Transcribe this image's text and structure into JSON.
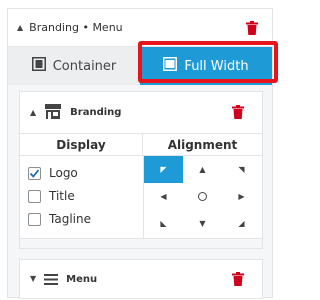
{
  "header": {
    "title_part1": "Branding",
    "separator": "•",
    "title_part2": "Menu"
  },
  "tabs": [
    {
      "label": "Container",
      "icon": "container-icon",
      "active": false
    },
    {
      "label": "Full Width",
      "icon": "full-width-icon",
      "active": true
    }
  ],
  "branding": {
    "title": "Branding",
    "icon": "store-icon",
    "display_header": "Display",
    "alignment_header": "Alignment",
    "options": [
      {
        "label": "Logo",
        "checked": true
      },
      {
        "label": "Title",
        "checked": false
      },
      {
        "label": "Tagline",
        "checked": false
      }
    ],
    "alignment_glyphs": [
      "◤",
      "▲",
      "◥",
      "◀",
      "○",
      "▶",
      "◣",
      "▼",
      "◢"
    ],
    "alignment_selected": "top-left"
  },
  "menu": {
    "title": "Menu",
    "icon": "hamburger-icon"
  },
  "colors": {
    "accent": "#1e9ad6",
    "delete": "#d0021b",
    "highlight": "#e8141c"
  }
}
